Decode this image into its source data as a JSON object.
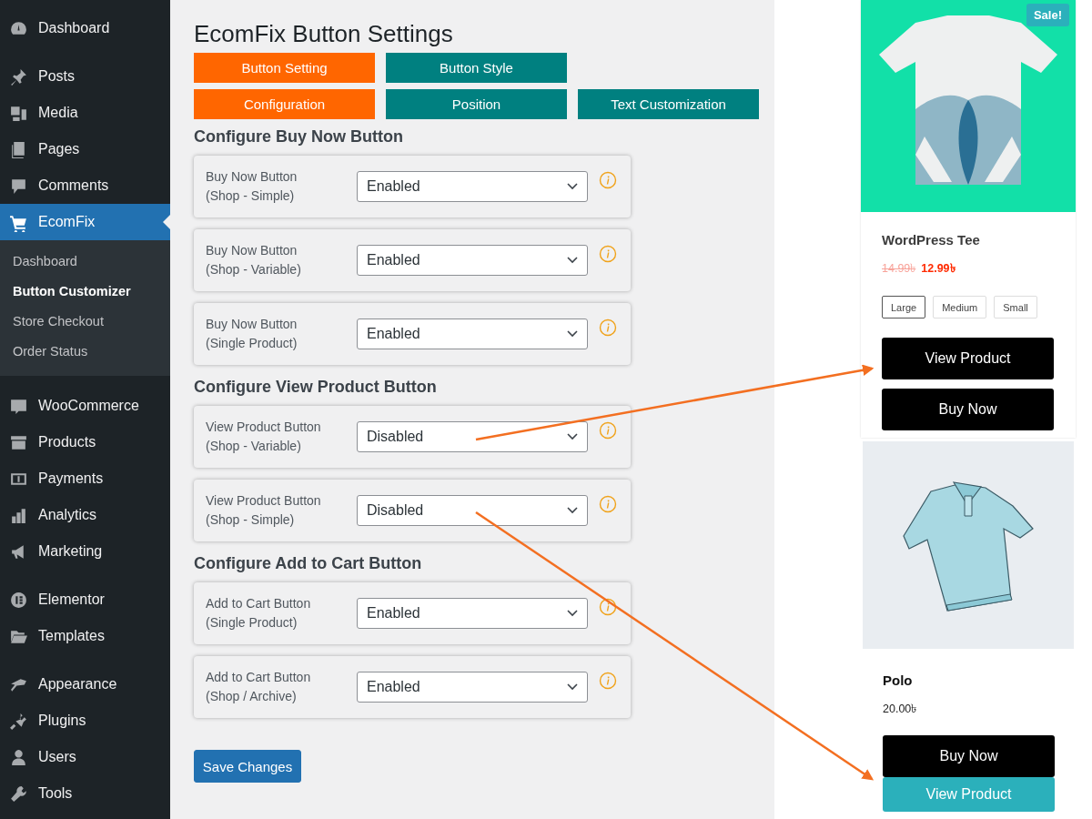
{
  "sidebar": {
    "groups": [
      {
        "items": [
          {
            "label": "Dashboard",
            "selected": false
          }
        ]
      },
      {
        "items": [
          {
            "label": "Posts",
            "selected": false
          },
          {
            "label": "Media",
            "selected": false
          },
          {
            "label": "Pages",
            "selected": false
          },
          {
            "label": "Comments",
            "selected": false
          },
          {
            "label": "EcomFix",
            "selected": true,
            "submenu": [
              {
                "label": "Dashboard",
                "selected": false
              },
              {
                "label": "Button Customizer",
                "selected": true
              },
              {
                "label": "Store Checkout",
                "selected": false
              },
              {
                "label": "Order Status",
                "selected": false
              }
            ]
          }
        ]
      },
      {
        "items": [
          {
            "label": "WooCommerce",
            "selected": false
          },
          {
            "label": "Products",
            "selected": false
          },
          {
            "label": "Payments",
            "selected": false
          },
          {
            "label": "Analytics",
            "selected": false
          },
          {
            "label": "Marketing",
            "selected": false
          }
        ]
      },
      {
        "items": [
          {
            "label": "Elementor",
            "selected": false
          },
          {
            "label": "Templates",
            "selected": false
          }
        ]
      },
      {
        "items": [
          {
            "label": "Appearance",
            "selected": false
          },
          {
            "label": "Plugins",
            "selected": false
          },
          {
            "label": "Users",
            "selected": false
          },
          {
            "label": "Tools",
            "selected": false
          }
        ]
      }
    ]
  },
  "settings": {
    "title": "EcomFix Button Settings",
    "tab_rows": [
      [
        {
          "label": "Button Setting",
          "selected": true
        },
        {
          "label": "Button Style",
          "selected": false
        }
      ],
      [
        {
          "label": "Configuration",
          "selected": true
        },
        {
          "label": "Position",
          "selected": false
        },
        {
          "label": "Text Customization",
          "selected": false
        }
      ]
    ],
    "sections": [
      {
        "heading": "Configure Buy Now Button",
        "rows": [
          {
            "label": "Buy Now Button",
            "note": "(Shop - Simple)",
            "value": "Enabled"
          },
          {
            "label": "Buy Now Button",
            "note": "(Shop - Variable)",
            "value": "Enabled"
          },
          {
            "label": "Buy Now Button",
            "note": "(Single Product)",
            "value": "Enabled"
          }
        ]
      },
      {
        "heading": "Configure View Product Button",
        "rows": [
          {
            "label": "View Product Button",
            "note": "(Shop - Variable)",
            "value": "Disabled"
          },
          {
            "label": "View Product Button",
            "note": "(Shop - Simple)",
            "value": "Disabled"
          }
        ]
      },
      {
        "heading": "Configure Add to Cart Button",
        "rows": [
          {
            "label": "Add to Cart Button",
            "note": "(Single Product)",
            "value": "Enabled"
          },
          {
            "label": "Add to Cart Button",
            "note": "(Shop / Archive)",
            "value": "Enabled"
          }
        ]
      }
    ],
    "save_button": "Save Changes"
  },
  "products": [
    {
      "kind": "tee",
      "badge": "Sale!",
      "name": "WordPress Tee",
      "old_price": "14.99৳",
      "price": "12.99৳",
      "sizes": [
        {
          "label": "Large",
          "selected": true
        },
        {
          "label": "Medium",
          "selected": false
        },
        {
          "label": "Small",
          "selected": false
        }
      ],
      "buttons": [
        {
          "label": "View Product",
          "kind": "dark"
        },
        {
          "label": "Buy Now",
          "kind": "dark"
        }
      ]
    },
    {
      "kind": "polo",
      "name": "Polo",
      "price": "20.00৳",
      "buttons": [
        {
          "label": "Buy Now",
          "kind": "dark"
        },
        {
          "label": "View Product",
          "kind": "teal"
        }
      ]
    }
  ]
}
